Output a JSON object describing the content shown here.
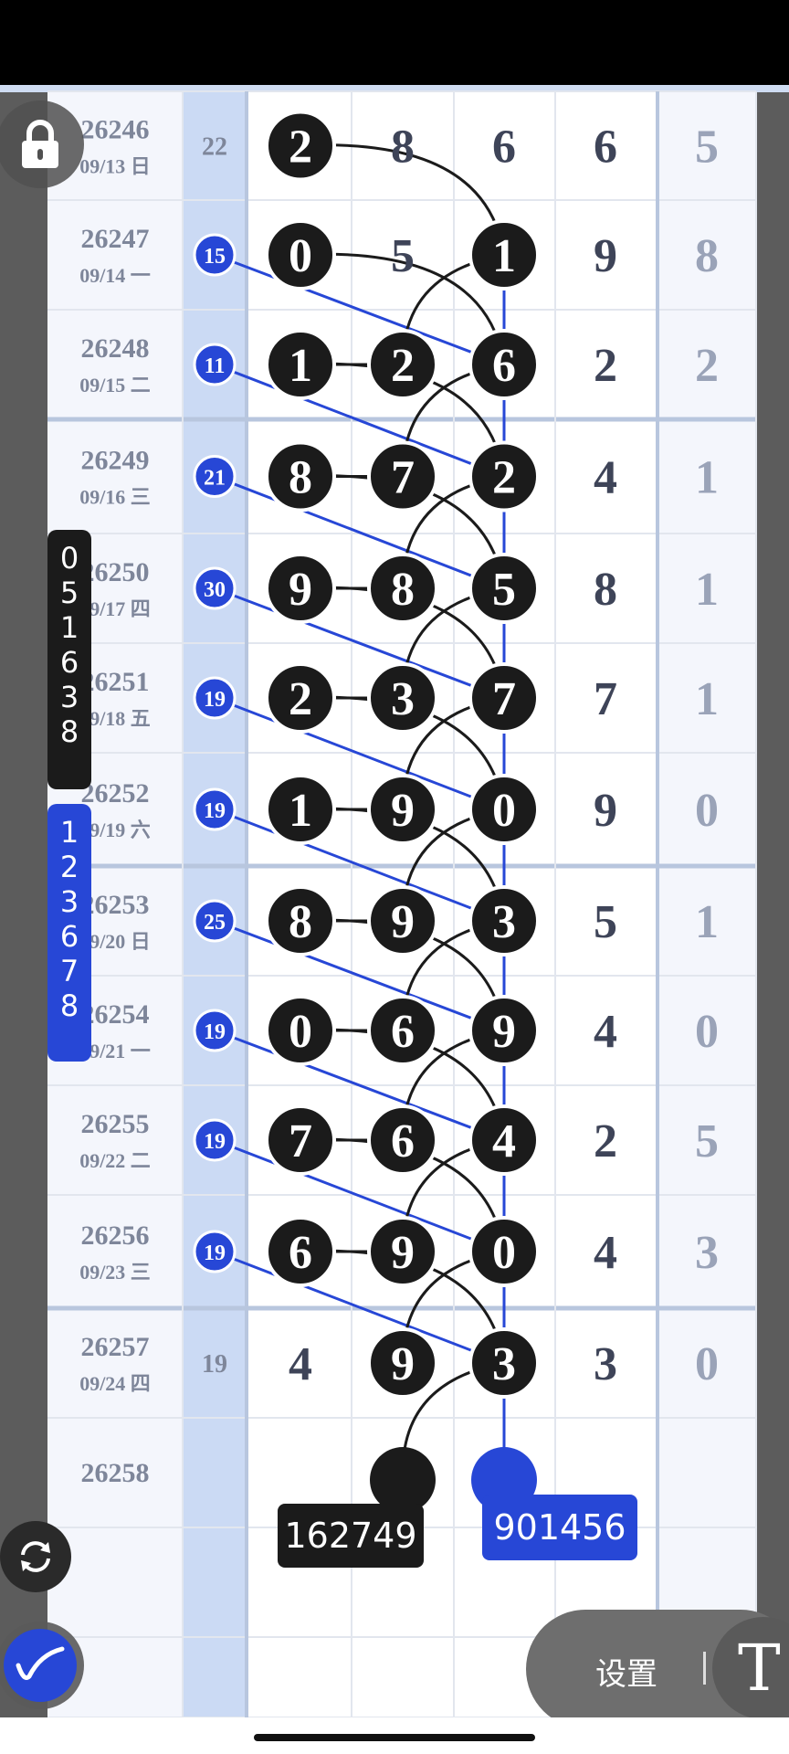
{
  "colors": {
    "black_ball": "#1b1b1b",
    "blue_accent": "#2747d6",
    "grid_bg": "#f4f6fc",
    "highlight_col": "#cbdaf4",
    "text_gray": "#7e869a",
    "text_dark": "#3e4458"
  },
  "rows": [
    {
      "issue": "26246",
      "date": "09/13 日",
      "sum": "22",
      "sum_blue": false,
      "digits": [
        "2",
        "8",
        "6",
        "6"
      ],
      "extra": "5",
      "balls": [
        true,
        false,
        false,
        false
      ]
    },
    {
      "issue": "26247",
      "date": "09/14 一",
      "sum": "15",
      "sum_blue": true,
      "digits": [
        "0",
        "5",
        "1",
        "9"
      ],
      "extra": "8",
      "balls": [
        true,
        false,
        true,
        false
      ]
    },
    {
      "issue": "26248",
      "date": "09/15 二",
      "sum": "11",
      "sum_blue": true,
      "digits": [
        "1",
        "2",
        "6",
        "2"
      ],
      "extra": "2",
      "balls": [
        true,
        true,
        true,
        false
      ]
    },
    {
      "issue": "26249",
      "date": "09/16 三",
      "sum": "21",
      "sum_blue": true,
      "digits": [
        "8",
        "7",
        "2",
        "4"
      ],
      "extra": "1",
      "balls": [
        true,
        true,
        true,
        false
      ]
    },
    {
      "issue": "26250",
      "date": "09/17 四",
      "sum": "30",
      "sum_blue": true,
      "digits": [
        "9",
        "8",
        "5",
        "8"
      ],
      "extra": "1",
      "balls": [
        true,
        true,
        true,
        false
      ]
    },
    {
      "issue": "26251",
      "date": "09/18 五",
      "sum": "19",
      "sum_blue": true,
      "digits": [
        "2",
        "3",
        "7",
        "7"
      ],
      "extra": "1",
      "balls": [
        true,
        true,
        true,
        false
      ]
    },
    {
      "issue": "26252",
      "date": "09/19 六",
      "sum": "19",
      "sum_blue": true,
      "digits": [
        "1",
        "9",
        "0",
        "9"
      ],
      "extra": "0",
      "balls": [
        true,
        true,
        true,
        false
      ]
    },
    {
      "issue": "26253",
      "date": "09/20 日",
      "sum": "25",
      "sum_blue": true,
      "digits": [
        "8",
        "9",
        "3",
        "5"
      ],
      "extra": "1",
      "balls": [
        true,
        true,
        true,
        false
      ]
    },
    {
      "issue": "26254",
      "date": "09/21 一",
      "sum": "19",
      "sum_blue": true,
      "digits": [
        "0",
        "6",
        "9",
        "4"
      ],
      "extra": "0",
      "balls": [
        true,
        true,
        true,
        false
      ]
    },
    {
      "issue": "26255",
      "date": "09/22 二",
      "sum": "19",
      "sum_blue": true,
      "digits": [
        "7",
        "6",
        "4",
        "2"
      ],
      "extra": "5",
      "balls": [
        true,
        true,
        true,
        false
      ]
    },
    {
      "issue": "26256",
      "date": "09/23 三",
      "sum": "19",
      "sum_blue": true,
      "digits": [
        "6",
        "9",
        "0",
        "4"
      ],
      "extra": "3",
      "balls": [
        true,
        true,
        true,
        false
      ]
    },
    {
      "issue": "26257",
      "date": "09/24 四",
      "sum": "19",
      "sum_blue": false,
      "digits": [
        "4",
        "9",
        "3",
        "3"
      ],
      "extra": "0",
      "balls": [
        false,
        true,
        true,
        false
      ]
    },
    {
      "issue": "26258",
      "date": "",
      "sum": "",
      "sum_blue": false,
      "digits": [
        "",
        "",
        "",
        ""
      ],
      "extra": "",
      "balls": [
        false,
        false,
        false,
        false
      ]
    }
  ],
  "side_black": [
    "0",
    "5",
    "1",
    "6",
    "3",
    "8"
  ],
  "side_blue": [
    "1",
    "2",
    "3",
    "6",
    "7",
    "8"
  ],
  "result_black": "162749",
  "result_blue": "901456",
  "settings_label": "设置",
  "t_button": "T",
  "icons": {
    "lock": "lock-icon",
    "refresh": "refresh-icon",
    "pen": "pen-icon"
  }
}
